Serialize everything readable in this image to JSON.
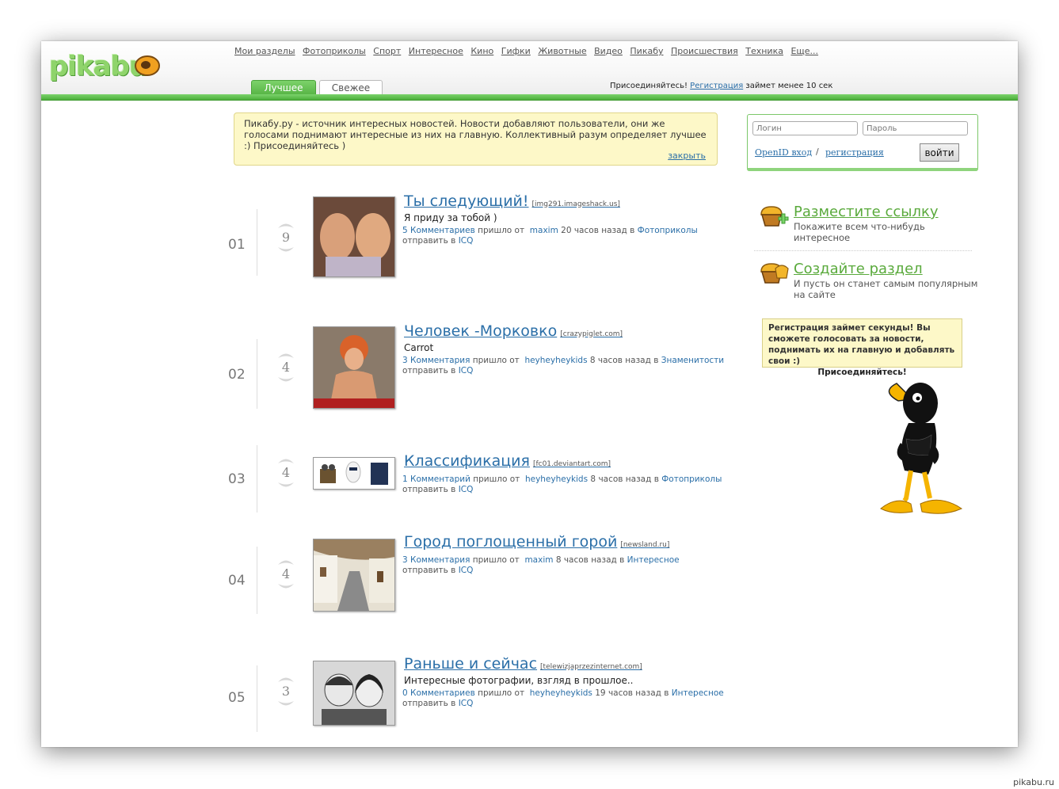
{
  "nav": [
    "Мои разделы",
    "Фотоприколы",
    "Спорт",
    "Интересное",
    "Кино",
    "Гифки",
    "Животные",
    "Видео",
    "Пикабу",
    "Происшествия",
    "Техника",
    "Еще..."
  ],
  "logo": "pikabu",
  "tabs": {
    "best": "Лучшее",
    "new": "Свежее"
  },
  "join": {
    "text": "Присоединяйтесь!",
    "link": "Регистрация",
    "tail": "займет менее 10 сек"
  },
  "notice": {
    "text": "Пикабу.ру - источник интересных новостей. Новости добавляют пользователи, они же голосами поднимают интересные из них на главную. Коллективный разум определяет лучшее :) Присоединяйтесь )",
    "close": "закрыть"
  },
  "login": {
    "login_placeholder": "Логин",
    "password_placeholder": "Пароль",
    "openid": "OpenID вход",
    "sep": "/",
    "register": "регистрация",
    "submit": "войти"
  },
  "side": {
    "post_link": {
      "title": "Разместите ссылку",
      "desc": "Покажите всем что-нибудь интересное"
    },
    "create_section": {
      "title": "Создайте раздел",
      "desc": "И пусть он станет самым популярным на сайте"
    },
    "bubble": {
      "text": "Регистрация займет секунды! Вы сможете голосовать за новости, поднимать их на главную и добавлять свои :)",
      "join": "Присоединяйтесь!"
    }
  },
  "posts": [
    {
      "num": "01",
      "score": "9",
      "title": "Ты следующий!",
      "src": "[img291.imageshack.us]",
      "desc": "Я приду за тобой )",
      "comments": "5 Комментариев",
      "came": "пришло от",
      "user": "maxim",
      "time": "20 часов назад в",
      "section": "Фотоприколы",
      "send": "отправить в",
      "icq": "ICQ"
    },
    {
      "num": "02",
      "score": "4",
      "title": "Человек -Морковко",
      "src": "[crazypiglet.com]",
      "desc": "Carrot",
      "comments": "3 Комментария",
      "came": "пришло от",
      "user": "heyheyheykids",
      "time": "8 часов назад в",
      "section": "Знаменитости",
      "send": "отправить в",
      "icq": "ICQ"
    },
    {
      "num": "03",
      "score": "4",
      "title": "Классификация",
      "src": "[fc01.deviantart.com]",
      "desc": "",
      "comments": "1 Комментарий",
      "came": "пришло от",
      "user": "heyheyheykids",
      "time": "8 часов назад в",
      "section": "Фотоприколы",
      "send": "отправить в",
      "icq": "ICQ"
    },
    {
      "num": "04",
      "score": "4",
      "title": "Город поглощенный горой",
      "src": "[newsland.ru]",
      "desc": "",
      "comments": "3 Комментария",
      "came": "пришло от",
      "user": "maxim",
      "time": "8 часов назад в",
      "section": "Интересное",
      "send": "отправить в",
      "icq": "ICQ"
    },
    {
      "num": "05",
      "score": "3",
      "title": "Раньше и сейчас",
      "src": "[telewizjaprzezinternet.com]",
      "desc": "Интересные фотографии, взгляд в прошлое..",
      "comments": "0 Комментариев",
      "came": "пришло от",
      "user": "heyheyheykids",
      "time": "19 часов назад в",
      "section": "Интересное",
      "send": "отправить в",
      "icq": "ICQ"
    }
  ],
  "watermark": "pikabu.ru"
}
